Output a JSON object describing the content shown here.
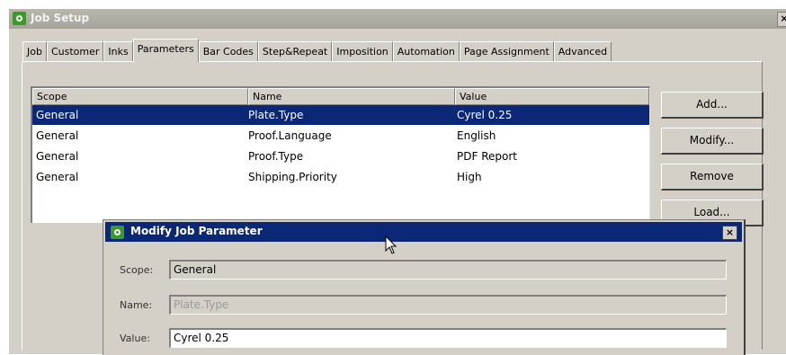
{
  "window": {
    "title": "Job Setup",
    "close": "×"
  },
  "tabs": [
    "Job",
    "Customer",
    "Inks",
    "Parameters",
    "Bar Codes",
    "Step&Repeat",
    "Imposition",
    "Automation",
    "Page Assignment",
    "Advanced"
  ],
  "active_tab": "Parameters",
  "table": {
    "columns": [
      "Scope",
      "Name",
      "Value"
    ],
    "rows": [
      [
        "General",
        "Plate.Type",
        "Cyrel 0.25"
      ],
      [
        "General",
        "Proof.Language",
        "English"
      ],
      [
        "General",
        "Proof.Type",
        "PDF Report"
      ],
      [
        "General",
        "Shipping.Priority",
        "High"
      ]
    ],
    "selected_row": 0
  },
  "buttons": {
    "add": "Add...",
    "modify": "Modify...",
    "remove": "Remove",
    "load": "Load..."
  },
  "dialog": {
    "title": "Modify Job Parameter",
    "close": "×",
    "scope_label": "Scope:",
    "scope_value": "General",
    "name_label": "Name:",
    "name_value": "Plate.Type",
    "value_label": "Value:",
    "value_value": "Cyrel 0.25"
  },
  "colors": {
    "selection": "#0b2877",
    "dialog_title": "#0b2877",
    "app_icon": "#3a9a2a",
    "window_face": "#d4d0c8"
  }
}
